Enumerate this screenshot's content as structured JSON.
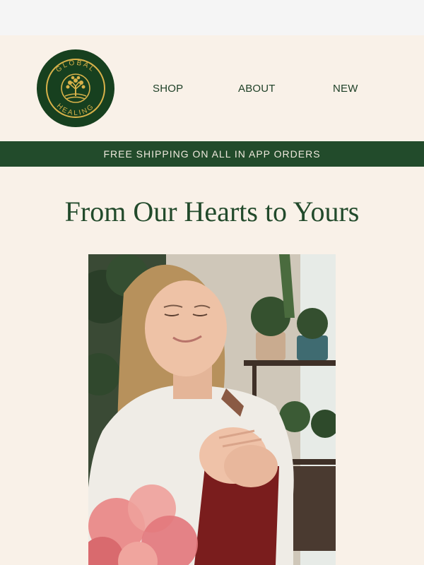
{
  "topbar": {},
  "header": {
    "logo": {
      "text_top": "GLOBAL",
      "text_bottom": "HEALING"
    },
    "nav": [
      {
        "label": "SHOP"
      },
      {
        "label": "ABOUT"
      },
      {
        "label": "NEW"
      }
    ]
  },
  "banner": {
    "text": "FREE SHIPPING ON ALL IN APP ORDERS"
  },
  "main": {
    "headline": "From Our Hearts to Yours",
    "hero_image": {
      "description": "woman-hands-on-heart-photo"
    }
  },
  "colors": {
    "background": "#f9f1e8",
    "brand_green": "#224b2b",
    "logo_gold": "#d8b24a"
  }
}
